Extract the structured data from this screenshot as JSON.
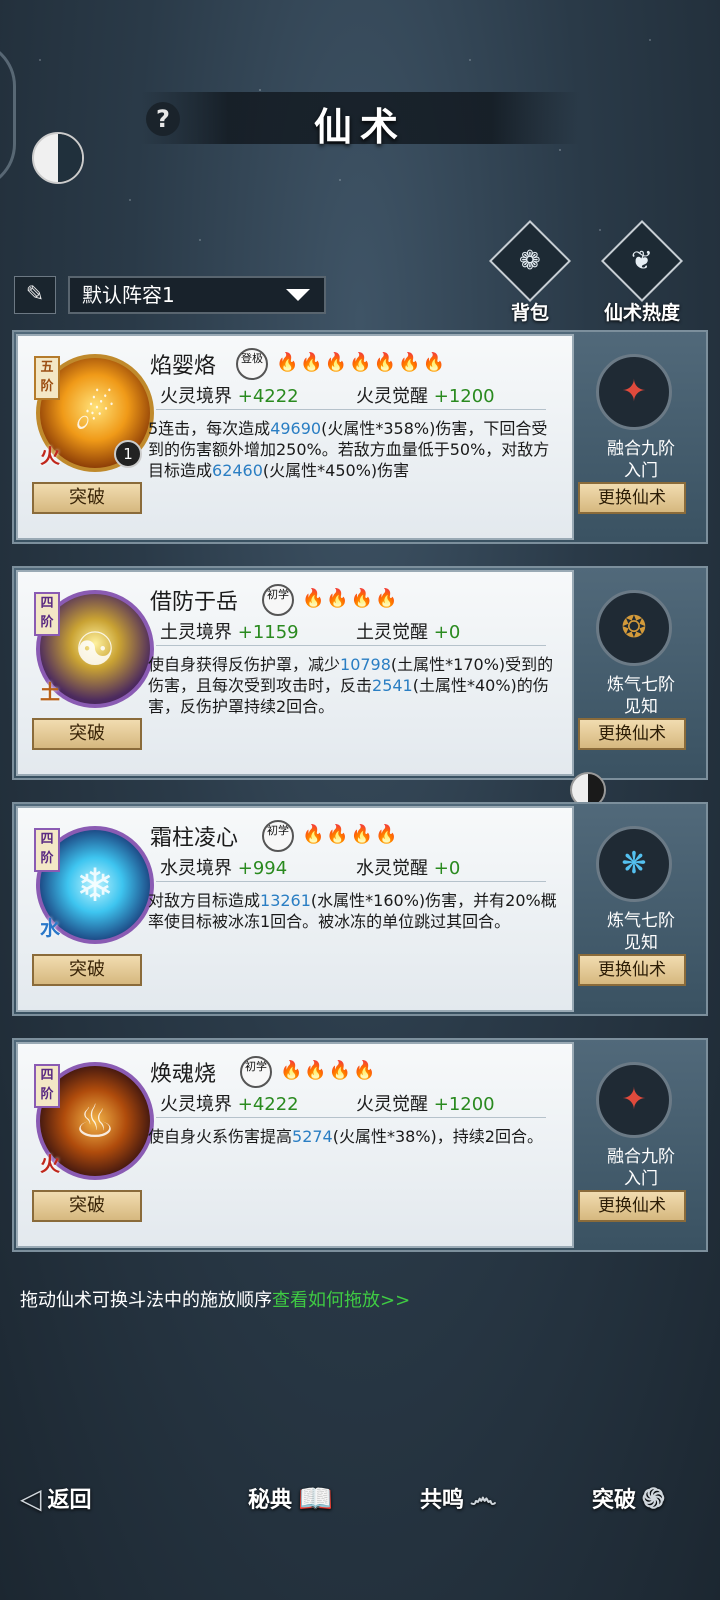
{
  "header": {
    "title": "仙术",
    "help_label": "?"
  },
  "top_buttons": [
    {
      "label": "背包",
      "icon": "bag-icon"
    },
    {
      "label": "仙术热度",
      "icon": "book-icon"
    }
  ],
  "formation": {
    "selected": "默认阵容1"
  },
  "skills": [
    {
      "tier": "五阶",
      "element": "火",
      "count": "1",
      "name": "焰婴烙",
      "badge": "登极",
      "flames_lit": 1,
      "flames_total": 7,
      "stat_a_label": "火灵境界",
      "stat_a_val": "+4222",
      "stat_b_label": "火灵觉醒",
      "stat_b_val": "+1200",
      "desc_parts": [
        "5连击，每次造成",
        "49690",
        "(火属性*358%)伤害，下回合受到的伤害额外增加250%。若敌方血量低于50%，对敌方目标造成",
        "62460",
        "(火属性*450%)伤害"
      ],
      "breakthrough": "突破",
      "realm_line1": "融合九阶",
      "realm_line2": "入门",
      "swap": "更换仙术"
    },
    {
      "tier": "四阶",
      "element": "土",
      "name": "借防于岳",
      "badge": "初学",
      "flames_lit": 0,
      "flames_total": 4,
      "stat_a_label": "土灵境界",
      "stat_a_val": "+1159",
      "stat_b_label": "土灵觉醒",
      "stat_b_val": "+0",
      "desc_parts": [
        "使自身获得反伤护罩，减少",
        "10798",
        "(土属性*170%)受到的伤害，且每次受到攻击时，反击",
        "2541",
        "(土属性*40%)的伤害，反伤护罩持续2回合。"
      ],
      "breakthrough": "突破",
      "realm_line1": "炼气七阶",
      "realm_line2": "见知",
      "swap": "更换仙术"
    },
    {
      "tier": "四阶",
      "element": "水",
      "name": "霜柱凌心",
      "badge": "初学",
      "flames_lit": 0,
      "flames_total": 4,
      "stat_a_label": "水灵境界",
      "stat_a_val": "+994",
      "stat_b_label": "水灵觉醒",
      "stat_b_val": "+0",
      "desc_parts": [
        "对敌方目标造成",
        "13261",
        "(水属性*160%)伤害，并有20%概率使目标被冰冻1回合。被冰冻的单位跳过其回合。",
        "",
        ""
      ],
      "breakthrough": "突破",
      "realm_line1": "炼气七阶",
      "realm_line2": "见知",
      "swap": "更换仙术"
    },
    {
      "tier": "四阶",
      "element": "火",
      "name": "焕魂烧",
      "badge": "初学",
      "flames_lit": 0,
      "flames_total": 4,
      "stat_a_label": "火灵境界",
      "stat_a_val": "+4222",
      "stat_b_label": "火灵觉醒",
      "stat_b_val": "+1200",
      "desc_parts": [
        "使自身火系伤害提高",
        "5274",
        "(火属性*38%)，持续2回合。",
        "",
        ""
      ],
      "breakthrough": "突破",
      "realm_line1": "融合九阶",
      "realm_line2": "入门",
      "swap": "更换仙术"
    }
  ],
  "hint": {
    "text": "拖动仙术可换斗法中的施放顺序",
    "link": "查看如何拖放>>"
  },
  "nav": [
    {
      "label": "返回",
      "icon": "back-arrow-icon"
    },
    {
      "label": "秘典",
      "icon": "book-icon"
    },
    {
      "label": "共鸣",
      "icon": "swirl-icon"
    },
    {
      "label": "突破",
      "icon": "spiral-icon"
    }
  ]
}
